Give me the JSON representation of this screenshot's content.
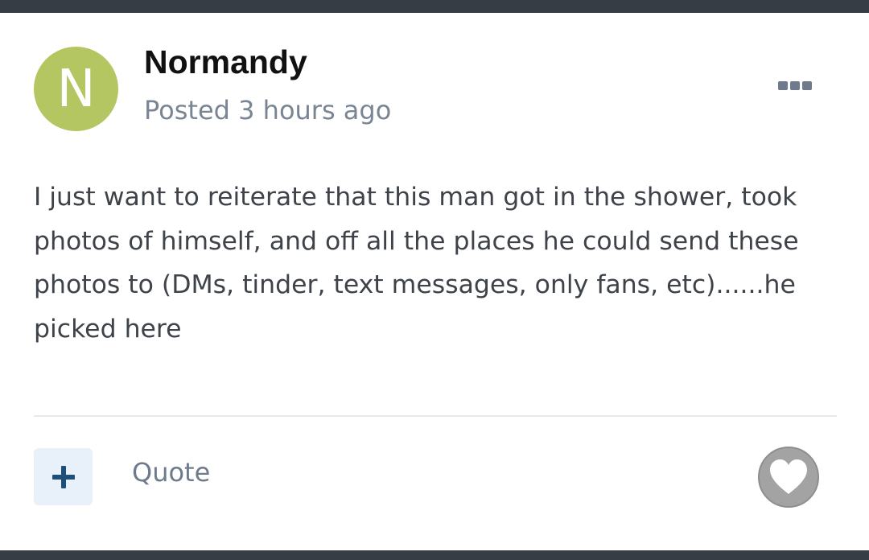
{
  "post": {
    "author": {
      "avatar_initial": "N",
      "avatar_color": "#b4c661",
      "name": "Normandy"
    },
    "meta": "Posted 3 hours ago",
    "menu_icon": "ellipsis-icon",
    "body": "I just want to reiterate that this man got in the shower, took photos of himself, and off all the places he could send these photos to (DMs, tinder, text messages, only fans, etc)......he picked here"
  },
  "actions": {
    "add_icon": "plus-icon",
    "quote_label": "Quote",
    "like_icon": "heart-icon"
  },
  "colors": {
    "accent": "#1d4f79",
    "bar": "#363d45",
    "muted_text": "#6e7b8c"
  }
}
